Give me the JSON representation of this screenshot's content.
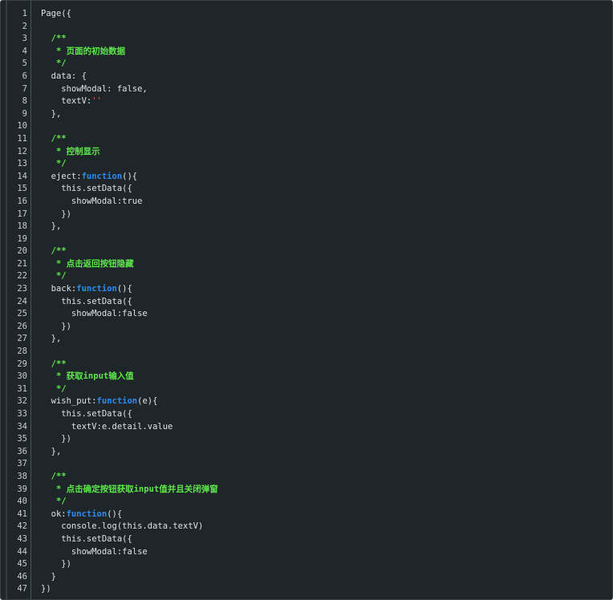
{
  "editor": {
    "colors": {
      "background": "#1f2629",
      "text": "#dfe2e3",
      "comment": "#5ce84a",
      "keyword": "#2f8af0",
      "string": "#ff4f4f",
      "line_number": "#c8ccce"
    },
    "lines": [
      {
        "n": "1",
        "tokens": [
          {
            "t": "Page({",
            "k": "default"
          }
        ]
      },
      {
        "n": "2",
        "tokens": []
      },
      {
        "n": "3",
        "tokens": [
          {
            "t": "  /**",
            "k": "comment"
          }
        ]
      },
      {
        "n": "4",
        "tokens": [
          {
            "t": "   * 页面的初始数据",
            "k": "comment"
          }
        ]
      },
      {
        "n": "5",
        "tokens": [
          {
            "t": "   */",
            "k": "comment"
          }
        ]
      },
      {
        "n": "6",
        "tokens": [
          {
            "t": "  data: {",
            "k": "default"
          }
        ]
      },
      {
        "n": "7",
        "tokens": [
          {
            "t": "    showModal: false,",
            "k": "default"
          }
        ]
      },
      {
        "n": "8",
        "tokens": [
          {
            "t": "    textV:",
            "k": "default"
          },
          {
            "t": "''",
            "k": "string"
          }
        ]
      },
      {
        "n": "9",
        "tokens": [
          {
            "t": "  },",
            "k": "default"
          }
        ]
      },
      {
        "n": "10",
        "tokens": []
      },
      {
        "n": "11",
        "tokens": [
          {
            "t": "  /**",
            "k": "comment"
          }
        ]
      },
      {
        "n": "12",
        "tokens": [
          {
            "t": "   * 控制显示",
            "k": "comment"
          }
        ]
      },
      {
        "n": "13",
        "tokens": [
          {
            "t": "   */",
            "k": "comment"
          }
        ]
      },
      {
        "n": "14",
        "tokens": [
          {
            "t": "  eject:",
            "k": "default"
          },
          {
            "t": "function",
            "k": "keyword"
          },
          {
            "t": "(){",
            "k": "default"
          }
        ]
      },
      {
        "n": "15",
        "tokens": [
          {
            "t": "    this.setData({",
            "k": "default"
          }
        ]
      },
      {
        "n": "16",
        "tokens": [
          {
            "t": "      showModal:true",
            "k": "default"
          }
        ]
      },
      {
        "n": "17",
        "tokens": [
          {
            "t": "    })",
            "k": "default"
          }
        ]
      },
      {
        "n": "18",
        "tokens": [
          {
            "t": "  },",
            "k": "default"
          }
        ]
      },
      {
        "n": "19",
        "tokens": []
      },
      {
        "n": "20",
        "tokens": [
          {
            "t": "  /**",
            "k": "comment"
          }
        ]
      },
      {
        "n": "21",
        "tokens": [
          {
            "t": "   * 点击返回按钮隐藏",
            "k": "comment"
          }
        ]
      },
      {
        "n": "22",
        "tokens": [
          {
            "t": "   */",
            "k": "comment"
          }
        ]
      },
      {
        "n": "23",
        "tokens": [
          {
            "t": "  back:",
            "k": "default"
          },
          {
            "t": "function",
            "k": "keyword"
          },
          {
            "t": "(){",
            "k": "default"
          }
        ]
      },
      {
        "n": "24",
        "tokens": [
          {
            "t": "    this.setData({",
            "k": "default"
          }
        ]
      },
      {
        "n": "25",
        "tokens": [
          {
            "t": "      showModal:false",
            "k": "default"
          }
        ]
      },
      {
        "n": "26",
        "tokens": [
          {
            "t": "    })",
            "k": "default"
          }
        ]
      },
      {
        "n": "27",
        "tokens": [
          {
            "t": "  },",
            "k": "default"
          }
        ]
      },
      {
        "n": "28",
        "tokens": []
      },
      {
        "n": "29",
        "tokens": [
          {
            "t": "  /**",
            "k": "comment"
          }
        ]
      },
      {
        "n": "30",
        "tokens": [
          {
            "t": "   * 获取input输入值",
            "k": "comment"
          }
        ]
      },
      {
        "n": "31",
        "tokens": [
          {
            "t": "   */",
            "k": "comment"
          }
        ]
      },
      {
        "n": "32",
        "tokens": [
          {
            "t": "  wish_put:",
            "k": "default"
          },
          {
            "t": "function",
            "k": "keyword"
          },
          {
            "t": "(e){",
            "k": "default"
          }
        ]
      },
      {
        "n": "33",
        "tokens": [
          {
            "t": "    this.setData({",
            "k": "default"
          }
        ]
      },
      {
        "n": "34",
        "tokens": [
          {
            "t": "      textV:e.detail.value",
            "k": "default"
          }
        ]
      },
      {
        "n": "35",
        "tokens": [
          {
            "t": "    })",
            "k": "default"
          }
        ]
      },
      {
        "n": "36",
        "tokens": [
          {
            "t": "  },",
            "k": "default"
          }
        ]
      },
      {
        "n": "37",
        "tokens": []
      },
      {
        "n": "38",
        "tokens": [
          {
            "t": "  /**",
            "k": "comment"
          }
        ]
      },
      {
        "n": "39",
        "tokens": [
          {
            "t": "   * 点击确定按钮获取input值并且关闭弹窗",
            "k": "comment"
          }
        ]
      },
      {
        "n": "40",
        "tokens": [
          {
            "t": "   */",
            "k": "comment"
          }
        ]
      },
      {
        "n": "41",
        "tokens": [
          {
            "t": "  ok:",
            "k": "default"
          },
          {
            "t": "function",
            "k": "keyword"
          },
          {
            "t": "(){",
            "k": "default"
          }
        ]
      },
      {
        "n": "42",
        "tokens": [
          {
            "t": "    console.log(this.data.textV)",
            "k": "default"
          }
        ]
      },
      {
        "n": "43",
        "tokens": [
          {
            "t": "    this.setData({",
            "k": "default"
          }
        ]
      },
      {
        "n": "44",
        "tokens": [
          {
            "t": "      showModal:false",
            "k": "default"
          }
        ]
      },
      {
        "n": "45",
        "tokens": [
          {
            "t": "    })",
            "k": "default"
          }
        ]
      },
      {
        "n": "46",
        "tokens": [
          {
            "t": "  }",
            "k": "default"
          }
        ]
      },
      {
        "n": "47",
        "tokens": [
          {
            "t": "})",
            "k": "default"
          }
        ]
      }
    ]
  }
}
